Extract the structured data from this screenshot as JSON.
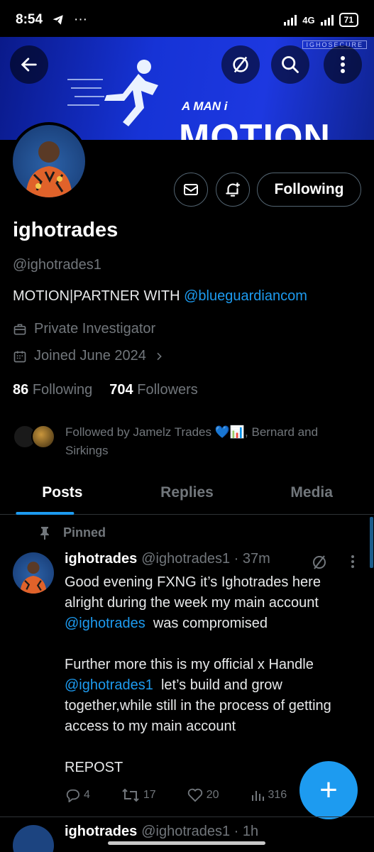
{
  "status_bar": {
    "time": "8:54",
    "network": "4G",
    "battery": "71"
  },
  "banner": {
    "tagline": "A MAN i",
    "title": "MOTION",
    "brand": "IGHOSECURE"
  },
  "profile": {
    "name": "ighotrades",
    "handle": "@ighotrades1",
    "bio_text": "MOTION|PARTNER WITH ",
    "bio_mention": "@blueguardiancom",
    "occupation": "Private Investigator",
    "joined": "Joined June 2024",
    "following_count": "86",
    "following_label": "Following",
    "followers_count": "704",
    "followers_label": "Followers",
    "followed_by": "Followed by Jamelz Trades 💙📊, Bernard and Sirkings"
  },
  "actions": {
    "following_button": "Following"
  },
  "tabs": [
    {
      "label": "Posts",
      "active": true
    },
    {
      "label": "Replies",
      "active": false
    },
    {
      "label": "Media",
      "active": false
    }
  ],
  "pinned_post": {
    "pinned_label": "Pinned",
    "author": "ighotrades",
    "handle_time": "@ighotrades1 · 37m",
    "lines": {
      "l1": "Good evening FXNG it’s Ighotrades here alright during the week my main account",
      "l1_mention": "@ighotrades",
      "l1_tail": "  was compromised",
      "l2": "Further more this is my official x Handle",
      "l2_mention": "@ighotrades1",
      "l2_tail": "  let’s build and grow together,while still in the process of getting access to my main account",
      "l3": "REPOST"
    },
    "replies": "4",
    "reposts": "17",
    "likes": "20",
    "views": "316"
  },
  "next_post": {
    "author": "ighotrades",
    "handle_time": "@ighotrades1 · 1h"
  },
  "fab": {
    "label": "+"
  },
  "colors": {
    "accent": "#1d9bf0",
    "background": "#000000",
    "muted": "#71767b",
    "banner": "#1d38e0"
  }
}
